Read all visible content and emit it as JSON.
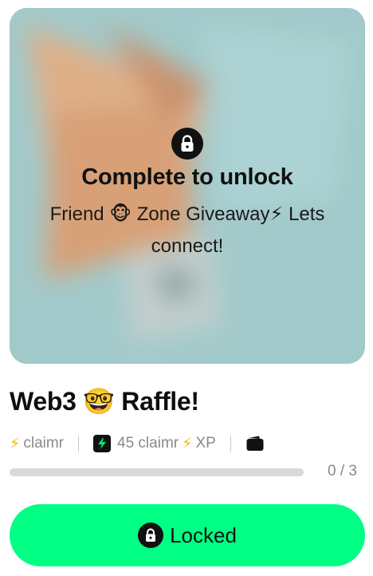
{
  "hero": {
    "overlay_icon": "lock-icon",
    "title": "Complete to unlock",
    "subtitle": "Friend 🐵 Zone Giveaway⚡ Lets connect!",
    "colors": {
      "background": "#9cc4c5",
      "fox_orange": "#f0a06a",
      "fox_dark": "#d27846"
    }
  },
  "quest": {
    "title": "Web3 🤓 Raffle!"
  },
  "meta": {
    "brand_icon": "bolt-icon",
    "brand": "claimr",
    "xp_icon": "bolt-badge-icon",
    "xp_text": "45 claimr",
    "xp_bolt": "⚡",
    "xp_unit": "XP",
    "wallet_icon": "wallet-icon"
  },
  "progress": {
    "label": "0 / 3",
    "done": 0,
    "total": 3
  },
  "cta": {
    "label": "Locked",
    "icon": "lock-icon",
    "color": "#00ff84"
  }
}
